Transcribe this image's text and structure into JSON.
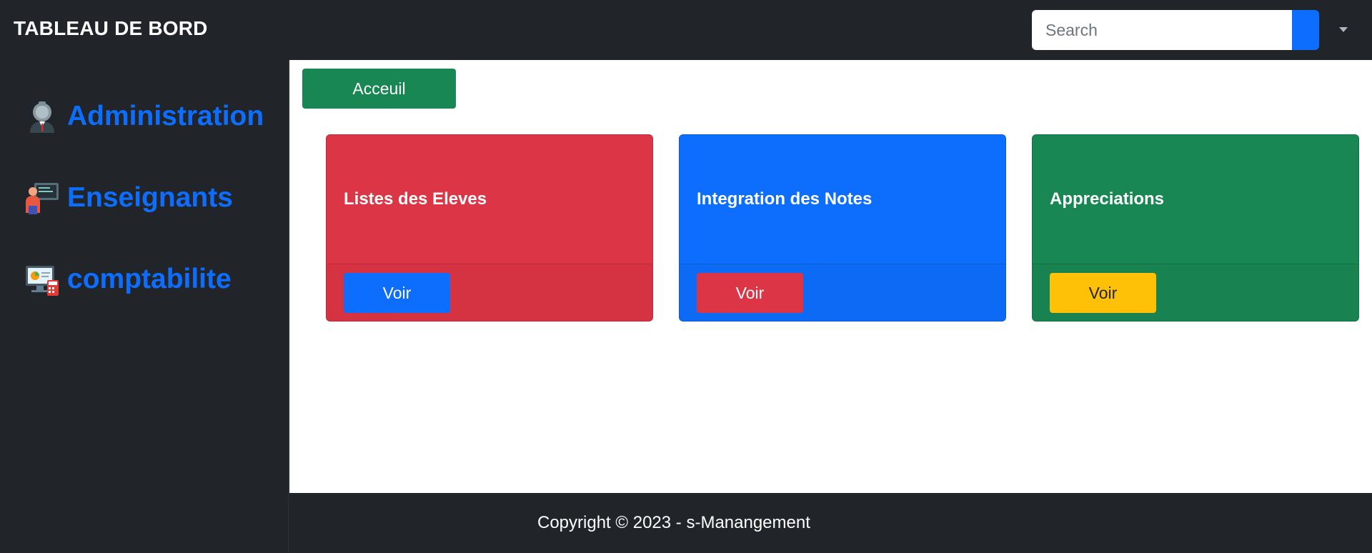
{
  "header": {
    "brand": "TABLEAU DE BORD",
    "search_placeholder": "Search"
  },
  "sidebar": {
    "items": [
      {
        "label": "Administration",
        "icon": "admin-user-icon"
      },
      {
        "label": "Enseignants",
        "icon": "teacher-icon"
      },
      {
        "label": "comptabilite",
        "icon": "accounting-computer-icon"
      }
    ]
  },
  "main": {
    "home_button": "Acceuil",
    "cards": [
      {
        "title": "Listes des Eleves",
        "button": "Voir",
        "color": "#dc3545",
        "button_color": "#0d6efd"
      },
      {
        "title": "Integration des Notes",
        "button": "Voir",
        "color": "#0d6efd",
        "button_color": "#dc3545"
      },
      {
        "title": "Appreciations",
        "button": "Voir",
        "color": "#198754",
        "button_color": "#ffc107"
      }
    ]
  },
  "footer": {
    "copyright": "Copyright © 2023 - s-Manangement"
  }
}
